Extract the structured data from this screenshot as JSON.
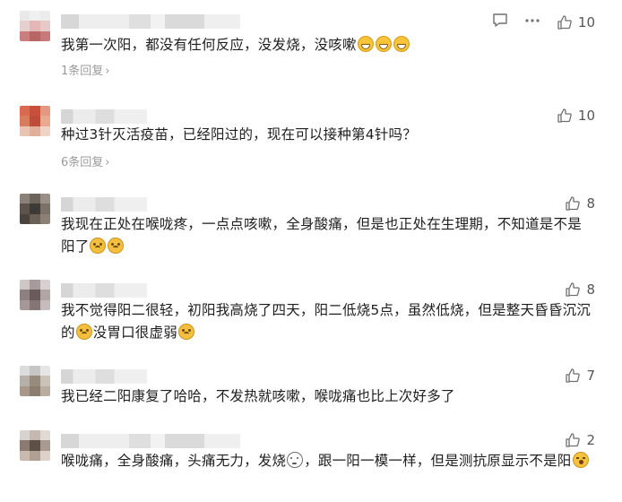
{
  "comments": [
    {
      "text": "我第一次阳，都没有任何反应，没发烧，没咳嗽",
      "emojis": [
        "grin-emoji",
        "grin-emoji",
        "grin-emoji"
      ],
      "likes": "10",
      "replies": "1条回复",
      "has_reply_icon": true
    },
    {
      "text": "种过3针灭活疫苗，已经阳过的，现在可以接种第4针吗？",
      "likes": "10",
      "replies": "6条回复"
    },
    {
      "text": "我现在正处在喉咙疼，一点点咳嗽，全身酸痛，但是也正处在生理期，不知道是不是阳了",
      "likes": "8"
    },
    {
      "text_a": "我不觉得阳二很轻，初阳我高烧了四天，阳二低烧5点，虽然低烧，但是整天昏昏沉沉的",
      "text_b": "没胃口很虚弱",
      "likes": "8"
    },
    {
      "text": "我已经二阳康复了哈哈，不发热就咳嗽，喉咙痛也比上次好多了",
      "likes": "7"
    },
    {
      "text_a": "喉咙痛，全身酸痛，头痛无力，发烧",
      "text_b": "，跟一阳一模一样，但是测抗原显示不是阳",
      "likes": "2"
    }
  ],
  "colors": {
    "text": "#1e1e1e",
    "muted": "#9b9b9b",
    "icon": "#6f6f6f"
  }
}
